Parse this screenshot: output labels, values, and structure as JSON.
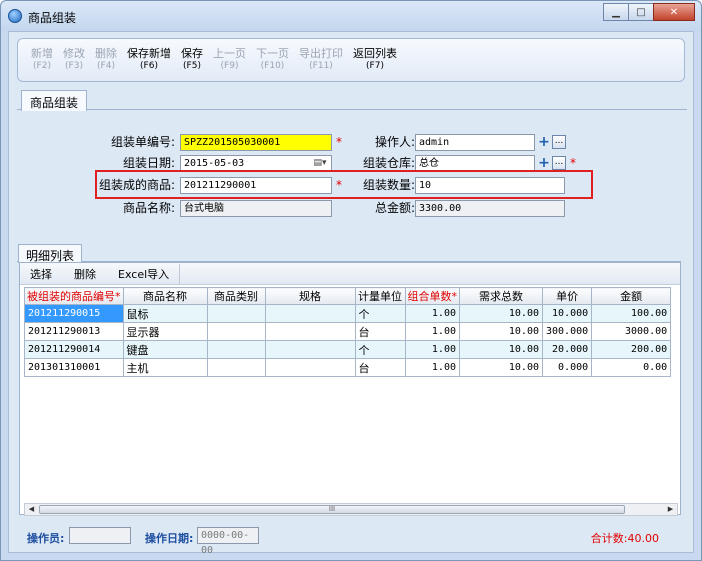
{
  "window": {
    "title": "商品组装"
  },
  "toolbar": [
    {
      "label": "新增",
      "key": "(F2)",
      "enabled": false
    },
    {
      "label": "修改",
      "key": "(F3)",
      "enabled": false
    },
    {
      "label": "删除",
      "key": "(F4)",
      "enabled": false
    },
    {
      "label": "保存新增",
      "key": "(F6)",
      "enabled": true
    },
    {
      "label": "保存",
      "key": "(F5)",
      "enabled": true
    },
    {
      "label": "上一页",
      "key": "(F9)",
      "enabled": false
    },
    {
      "label": "下一页",
      "key": "(F10)",
      "enabled": false
    },
    {
      "label": "导出打印",
      "key": "(F11)",
      "enabled": false
    },
    {
      "label": "返回列表",
      "key": "(F7)",
      "enabled": true
    }
  ],
  "tab": {
    "label": "商品组装"
  },
  "form": {
    "order_no": {
      "label": "组装单编号:",
      "value": "SPZZ201505030001"
    },
    "operator": {
      "label": "操作人:",
      "value": "admin"
    },
    "date": {
      "label": "组装日期:",
      "value": "2015-05-03"
    },
    "warehouse": {
      "label": "组装仓库:",
      "value": "总仓"
    },
    "product": {
      "label": "组装成的商品:",
      "value": "201211290001"
    },
    "quantity": {
      "label": "组装数量:",
      "value": "10"
    },
    "product_name": {
      "label": "商品名称:",
      "value": "台式电脑"
    },
    "total_amount": {
      "label": "总金额:",
      "value": "3300.00"
    },
    "required_mark": "*",
    "plus": "+",
    "ellipsis": "..."
  },
  "detail": {
    "tab_label": "明细列表",
    "actions": [
      "选择",
      "删除",
      "Excel导入"
    ],
    "columns": [
      "被组装的商品编号*",
      "商品名称",
      "商品类别",
      "规格",
      "计量单位",
      "组合单数*",
      "需求总数",
      "单价",
      "金额"
    ],
    "rows": [
      [
        "201211290015",
        "鼠标",
        "",
        "",
        "个",
        "1.00",
        "10.00",
        "10.000",
        "100.00"
      ],
      [
        "201211290013",
        "显示器",
        "",
        "",
        "台",
        "1.00",
        "10.00",
        "300.000",
        "3000.00"
      ],
      [
        "201211290014",
        "键盘",
        "",
        "",
        "个",
        "1.00",
        "10.00",
        "20.000",
        "200.00"
      ],
      [
        "201301310001",
        "主机",
        "",
        "",
        "台",
        "1.00",
        "10.00",
        "0.000",
        "0.00"
      ]
    ]
  },
  "status": {
    "operator_label": "操作员:",
    "operator_value": "",
    "date_label": "操作日期:",
    "date_value": "0000-00-00",
    "total": "合计数:40.00"
  },
  "colors": {
    "required": "#e00000",
    "highlight_field": "#ffff00",
    "selected_cell": "#3399ff",
    "callout_box": "#e02020"
  }
}
